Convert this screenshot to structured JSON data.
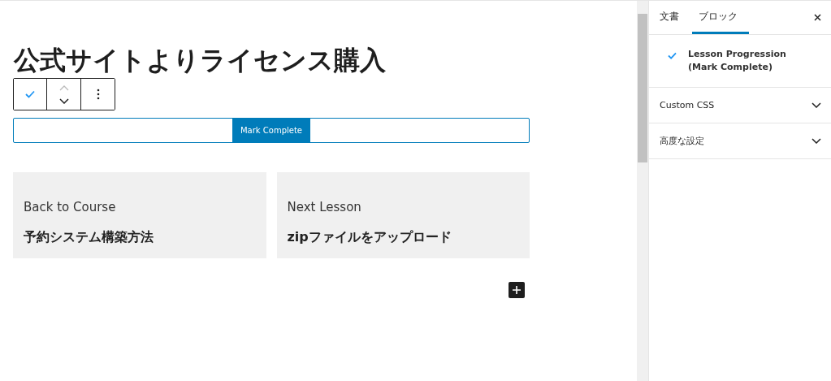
{
  "editor": {
    "title": "公式サイトよりライセンス購入",
    "mark_complete_button": "Mark Complete",
    "nav_cards": [
      {
        "label": "Back to Course",
        "lesson": "予約システム構築方法"
      },
      {
        "label": "Next Lesson",
        "lesson": "zipファイルをアップロード"
      }
    ]
  },
  "sidebar": {
    "tabs": [
      {
        "label": "文書",
        "selected": false
      },
      {
        "label": "ブロック",
        "selected": true
      }
    ],
    "block_name": "Lesson Progression (Mark Complete)",
    "panels": [
      {
        "title": "Custom CSS",
        "expanded": false
      },
      {
        "title": "高度な設定",
        "expanded": false
      }
    ]
  }
}
